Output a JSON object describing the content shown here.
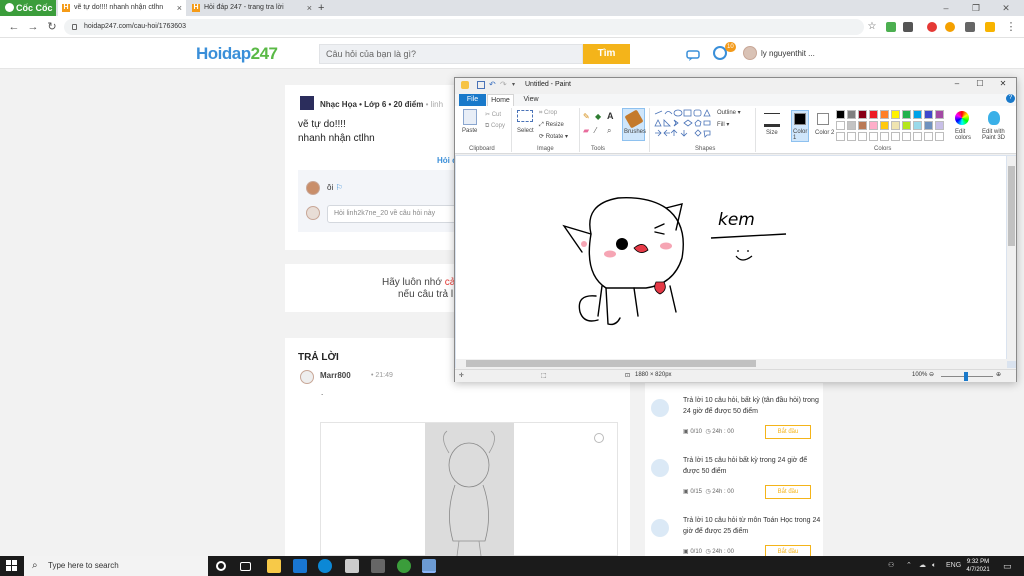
{
  "browser": {
    "brand": "Cốc Cốc",
    "tabs": [
      {
        "title": "vẽ tự do!!!! nhanh nhận ctlhn",
        "favicon": "H"
      },
      {
        "title": "Hỏi đáp 247 - trang tra lời",
        "favicon": "H"
      }
    ],
    "new_tab": "+",
    "window_controls": [
      "–",
      "❐",
      "✕"
    ],
    "url": "hoidap247.com/cau-hoi/1763603"
  },
  "site": {
    "logo_main": "Hoidap",
    "logo_num": "247",
    "search_placeholder": "Câu hỏi của bạn là gì?",
    "search_button": "Tìm",
    "notification_count": "10",
    "username": "ly nguyenthit ..."
  },
  "question": {
    "author_meta": "Nhạc Họa • Lớp 6 • 20 điểm",
    "author_trail": "• linh",
    "body_line1": "vẽ tự do!!!!",
    "body_line2": "nhanh nhận ctlhn",
    "link_text": "Hỏi c",
    "comment_text": "ôi",
    "comment_placeholder": "Hỏi linh2k7ne_20 về câu hỏi này"
  },
  "notice": {
    "line1_prefix": "Hãy luôn nhớ ",
    "line1_highlight": "cả",
    "line2": "nếu câu trả l"
  },
  "answer": {
    "section_title": "TRẢ LỜI",
    "user": "Marr800",
    "time": "• 21:49",
    "body": "."
  },
  "tasks": [
    {
      "text": "Trả lời 10 câu hỏi, bất kỳ (tân đầu hỏi) trong 24 giờ để được 50 điểm",
      "count": "0/10",
      "time": "24h : 00",
      "button": "Bắt đầu"
    },
    {
      "text": "Trả lời 15 câu hỏi bất kỳ trong 24 giờ để được 50 điểm",
      "count": "0/15",
      "time": "24h : 00",
      "button": "Bắt đầu"
    },
    {
      "text": "Trả lời 10 câu hỏi từ môn Toán Học trong 24 giờ để được 25 điểm",
      "count": "0/10",
      "time": "24h : 00",
      "button": "Bắt đầu"
    }
  ],
  "paint": {
    "title": "Untitled - Paint",
    "tabs": {
      "file": "File",
      "home": "Home",
      "view": "View"
    },
    "clipboard": {
      "paste": "Paste",
      "cut": "Cut",
      "copy": "Copy",
      "group": "Clipboard"
    },
    "image": {
      "select": "Select",
      "crop": "Crop",
      "resize": "Resize",
      "rotate": "Rotate ▾",
      "group": "Image"
    },
    "tools": {
      "group": "Tools"
    },
    "brushes": "Brushes",
    "shapes": {
      "outline": "Outline ▾",
      "fill": "Fill ▾",
      "group": "Shapes"
    },
    "size": "Size",
    "color1": "Color 1",
    "color2": "Color 2",
    "edit_colors": "Edit colors",
    "edit_paint3d": "Edit with Paint 3D",
    "colors_group": "Colors",
    "canvas_text": "kem",
    "canvas_size": "1880 × 820px",
    "zoom": "100%",
    "palette": [
      "#000000",
      "#7f7f7f",
      "#880015",
      "#ed1c24",
      "#ff7f27",
      "#fff200",
      "#22b14c",
      "#00a2e8",
      "#3f48cc",
      "#a349a4",
      "#ffffff",
      "#c3c3c3",
      "#b97a57",
      "#ffaec9",
      "#ffc90e",
      "#efe4b0",
      "#b5e61d",
      "#99d9ea",
      "#7092be",
      "#c8bfe7"
    ]
  },
  "taskbar": {
    "search_placeholder": "Type here to search",
    "lang": "ENG",
    "time": "9:32 PM",
    "date": "4/7/2021"
  }
}
